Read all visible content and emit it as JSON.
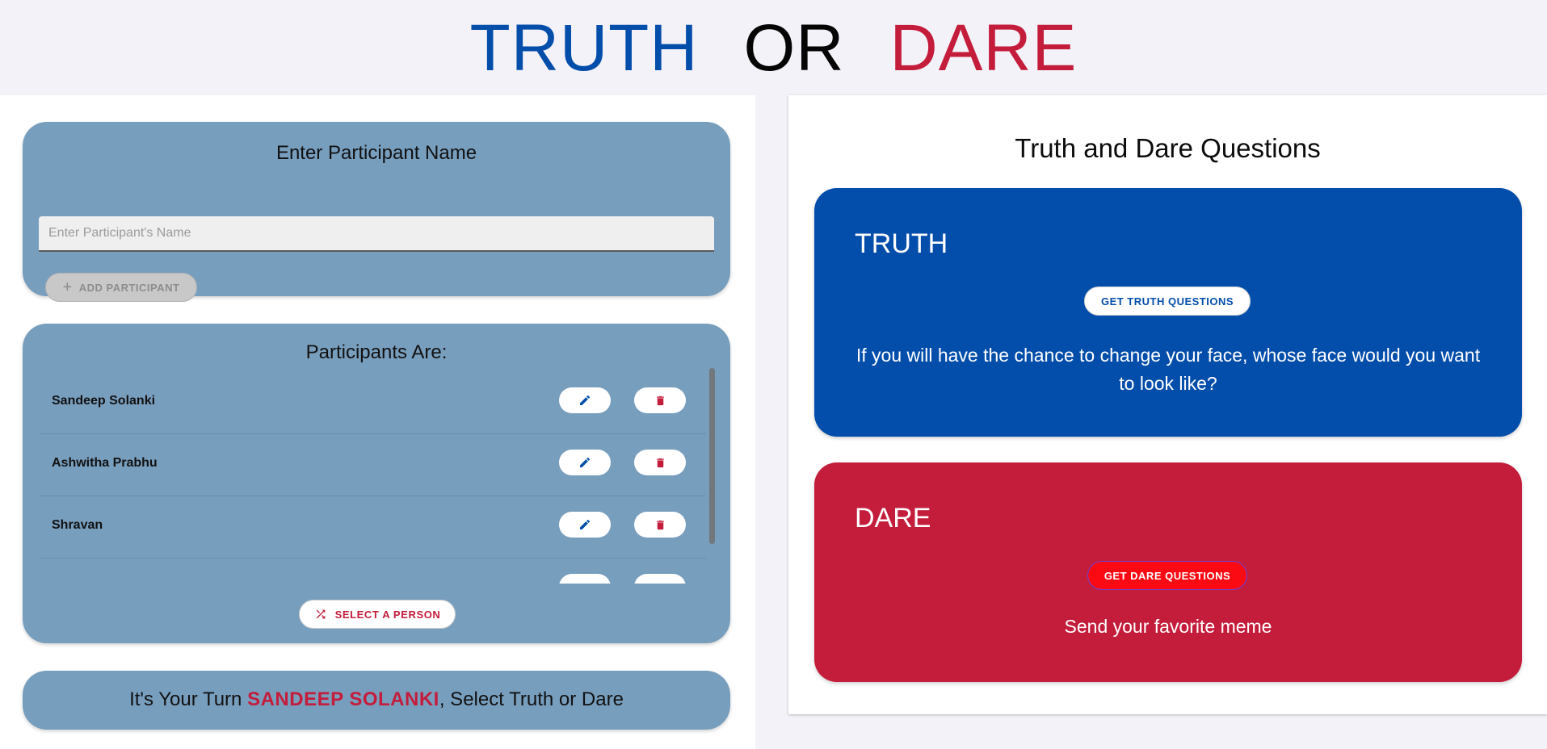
{
  "header": {
    "truth": "TRUTH",
    "or": "OR",
    "dare": "DARE"
  },
  "add_card": {
    "title": "Enter Participant Name",
    "input_placeholder": "Enter Participant's Name",
    "input_value": "",
    "add_label": "ADD PARTICIPANT"
  },
  "list_card": {
    "title": "Participants Are:",
    "participants": [
      "Sandeep Solanki",
      "Ashwitha Prabhu",
      "Shravan"
    ],
    "select_label": "SELECT A PERSON"
  },
  "turn": {
    "prefix": "It's Your Turn ",
    "name": "SANDEEP SOLANKI",
    "suffix": ", Select Truth or Dare"
  },
  "questions": {
    "title": "Truth and Dare Questions",
    "truth_heading": "TRUTH",
    "truth_button": "GET TRUTH QUESTIONS",
    "truth_text": "If you will have the chance to change your face, whose face would you want to look like?",
    "dare_heading": "DARE",
    "dare_button": "GET DARE QUESTIONS",
    "dare_text": "Send your favorite meme"
  },
  "colors": {
    "truth_blue": "#034eaa",
    "dare_red": "#c41c3b",
    "card_bg": "#789ebe"
  },
  "icons": {
    "edit": "pencil-icon",
    "delete": "trash-icon",
    "add": "plus-icon",
    "shuffle": "shuffle-icon"
  }
}
